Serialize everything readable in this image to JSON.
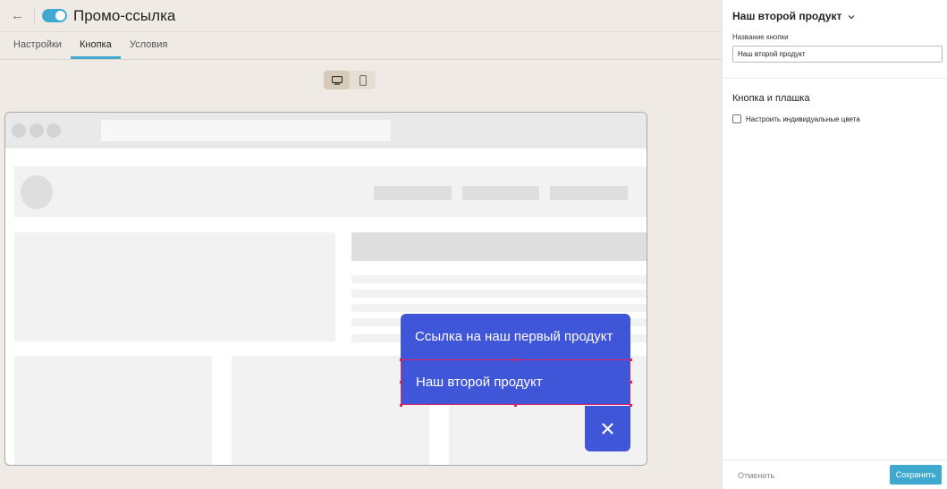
{
  "header": {
    "back_icon": "arrow-left-icon",
    "title": "Промо-ссылка",
    "toggle_on": true,
    "accent": "#3fa9d0"
  },
  "tabs": [
    {
      "label": "Настройки",
      "active": false
    },
    {
      "label": "Кнопка",
      "active": true
    },
    {
      "label": "Условия",
      "active": false
    }
  ],
  "device_switch": {
    "options": [
      "desktop-icon",
      "mobile-icon"
    ],
    "selected": "desktop-icon"
  },
  "preview": {
    "buttons": [
      {
        "label": "Ссылка на наш первый продукт"
      },
      {
        "label": "Наш второй продукт",
        "selected": true
      }
    ],
    "close_icon": "close-icon",
    "button_color": "#4056d9",
    "selection_color": "#e0235e"
  },
  "panel": {
    "title": "Наш второй продукт",
    "title_icon": "chevron-down-icon",
    "field_label": "Название кнопки",
    "field_value": "Наш второй продукт",
    "section_title": "Кнопка и плашка",
    "checkbox_label": "Настроить индивидуальные цвета",
    "checkbox_checked": false,
    "cancel_label": "Отменить",
    "save_label": "Сохранить"
  }
}
